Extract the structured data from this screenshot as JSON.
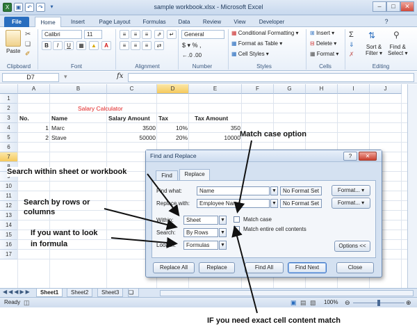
{
  "window": {
    "title": "sample workbook.xlsx - Microsoft Excel"
  },
  "tabs": [
    "File",
    "Home",
    "Insert",
    "Page Layout",
    "Formulas",
    "Data",
    "Review",
    "View",
    "Developer"
  ],
  "ribbon": {
    "paste": "Paste",
    "font_name": "Calibri",
    "font_size": "11",
    "number_format": "General",
    "conditional_formatting": "Conditional Formatting",
    "format_as_table": "Format as Table",
    "cell_styles": "Cell Styles",
    "insert": "Insert",
    "delete": "Delete",
    "format": "Format",
    "sort_filter": "Sort &",
    "sort_filter2": "Filter",
    "find_select": "Find &",
    "find_select2": "Select",
    "groups": [
      "Clipboard",
      "Font",
      "Alignment",
      "Number",
      "Styles",
      "Cells",
      "Editing"
    ]
  },
  "formula_bar": {
    "name_box": "D7",
    "fx": "fx"
  },
  "grid": {
    "columns": [
      "A",
      "B",
      "C",
      "D",
      "E",
      "F",
      "G",
      "H",
      "I",
      "J"
    ],
    "rows": [
      "1",
      "2",
      "3",
      "4",
      "5",
      "6",
      "7",
      "8",
      "9",
      "10",
      "11",
      "12",
      "13",
      "14",
      "15",
      "16",
      "17"
    ],
    "active_column": "D",
    "active_row": "7",
    "title": "Salary Calculator",
    "title_color": "#e02020",
    "headers": [
      "No.",
      "Name",
      "Salary Amount",
      "Tax",
      "Tax Amount"
    ],
    "data": [
      [
        "1",
        "Marc",
        "3500",
        "10%",
        "350"
      ],
      [
        "2",
        "Stave",
        "50000",
        "20%",
        "10000"
      ]
    ]
  },
  "sheet_tabs": [
    "Sheet1",
    "Sheet2",
    "Sheet3"
  ],
  "status": {
    "ready": "Ready",
    "zoom": "100%"
  },
  "dialog": {
    "title": "Find and Replace",
    "help": "?",
    "tabs": [
      "Find",
      "Replace"
    ],
    "find_what_label": "Find what:",
    "find_what_value": "Name",
    "replace_with_label": "Replace with:",
    "replace_with_value": "Employee Name",
    "no_format_1": "No Format Set",
    "no_format_2": "No Format Set",
    "format_1": "Format...",
    "format_2": "Format...",
    "within_label": "Within:",
    "within_value": "Sheet",
    "search_label": "Search:",
    "search_value": "By Rows",
    "lookin_label": "Look in:",
    "lookin_value": "Formulas",
    "match_case": "Match case",
    "match_entire": "Match entire cell contents",
    "options": "Options <<",
    "buttons": [
      "Replace All",
      "Replace",
      "Find All",
      "Find Next",
      "Close"
    ]
  },
  "annotations": {
    "match_case_option": "Match case option",
    "search_within": "Search within sheet or workbook",
    "search_by_rows_1": "Search by rows or",
    "search_by_rows_2": "columns",
    "look_in_formula_1": "If you want to look",
    "look_in_formula_2": "in formula",
    "exact_match": "IF you need exact cell content match"
  }
}
